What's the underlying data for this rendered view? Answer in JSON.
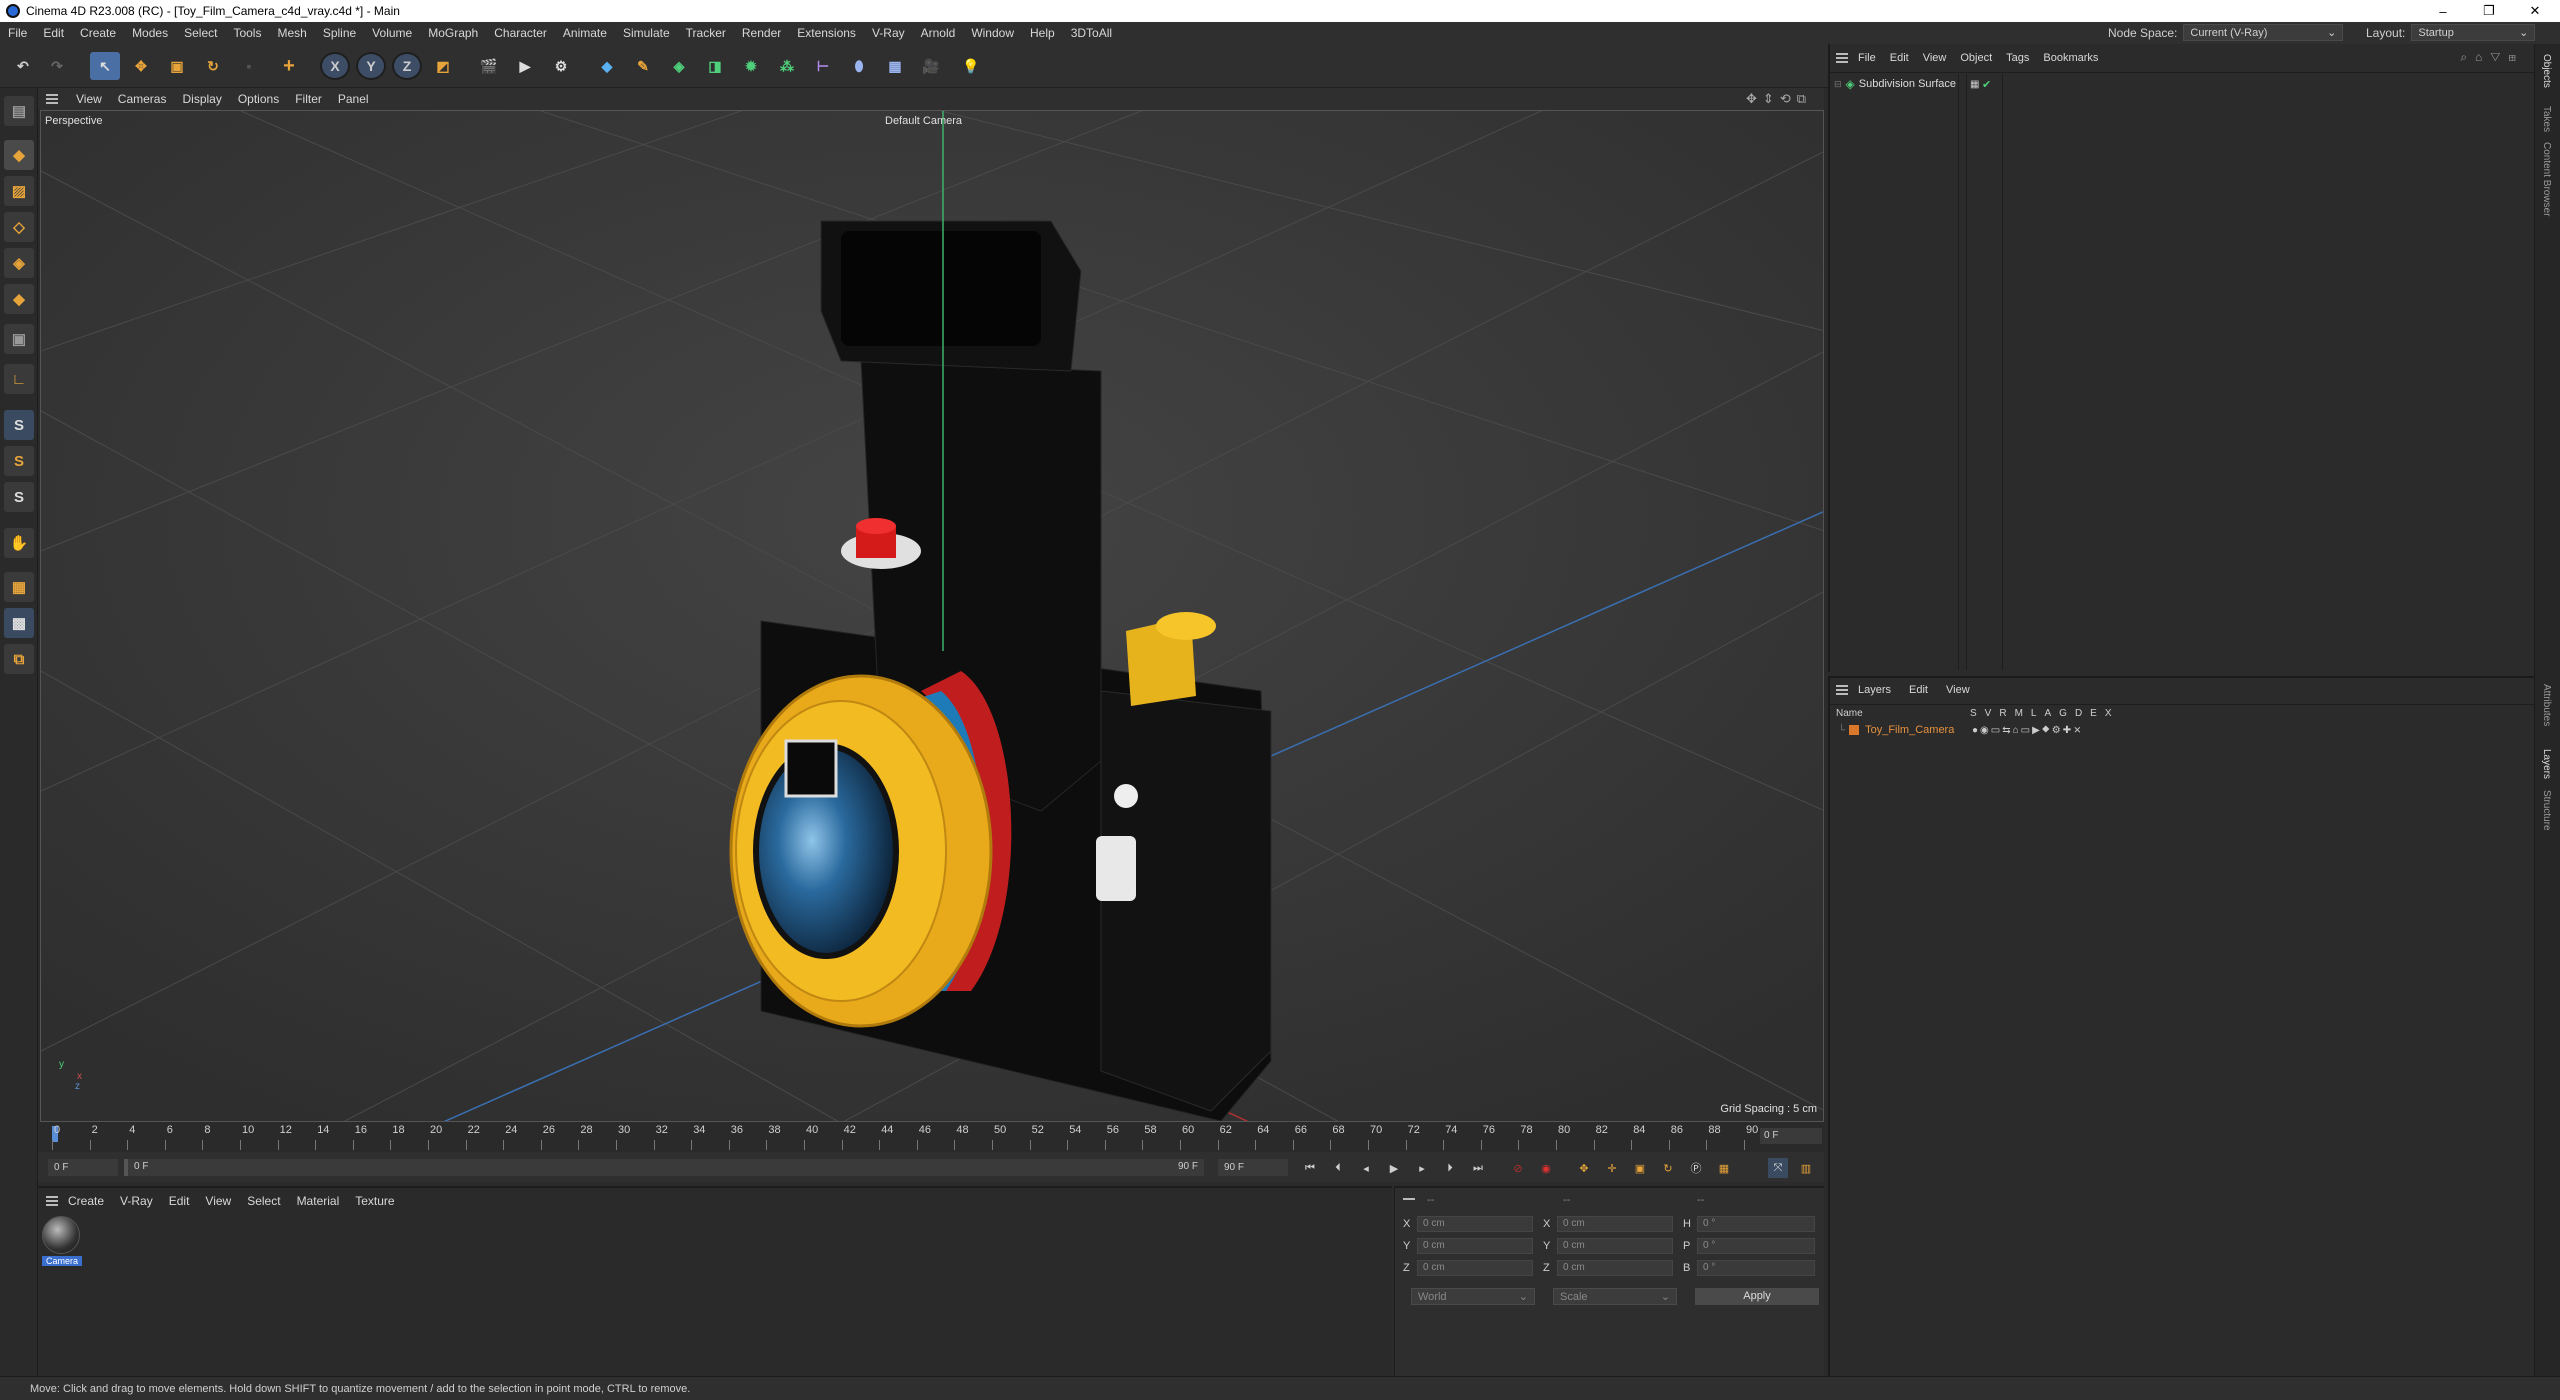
{
  "titlebar": {
    "title": "Cinema 4D R23.008 (RC) - [Toy_Film_Camera_c4d_vray.c4d *] - Main",
    "minimize": "–",
    "maximize": "❐",
    "close": "✕"
  },
  "menu": [
    "File",
    "Edit",
    "Create",
    "Modes",
    "Select",
    "Tools",
    "Mesh",
    "Spline",
    "Volume",
    "MoGraph",
    "Character",
    "Animate",
    "Simulate",
    "Tracker",
    "Render",
    "Extensions",
    "V-Ray",
    "Arnold",
    "Window",
    "Help",
    "3DToAll"
  ],
  "node_space": {
    "label": "Node Space:",
    "value": "Current (V-Ray)"
  },
  "layout": {
    "label": "Layout:",
    "value": "Startup"
  },
  "toolbar": {
    "x": "X",
    "y": "Y",
    "z": "Z"
  },
  "left_tools": {
    "s1": "S",
    "s2": "S",
    "s3": "S"
  },
  "viewport_menu": [
    "View",
    "Cameras",
    "Display",
    "Options",
    "Filter",
    "Panel"
  ],
  "viewport": {
    "view_name": "Perspective",
    "camera": "Default Camera",
    "grid_spacing": "Grid Spacing : 5 cm",
    "axis_x": "x",
    "axis_y": "y",
    "axis_z": "z"
  },
  "timeline": {
    "ticks": [
      "0",
      "2",
      "4",
      "6",
      "8",
      "10",
      "12",
      "14",
      "16",
      "18",
      "20",
      "22",
      "24",
      "26",
      "28",
      "30",
      "32",
      "34",
      "36",
      "38",
      "40",
      "42",
      "44",
      "46",
      "48",
      "50",
      "52",
      "54",
      "56",
      "58",
      "60",
      "62",
      "64",
      "66",
      "68",
      "70",
      "72",
      "74",
      "76",
      "78",
      "80",
      "82",
      "84",
      "86",
      "88",
      "90"
    ],
    "current_frame": "0 F"
  },
  "transport": {
    "start": "0 F",
    "range_start": "0 F",
    "range_end": "90 F",
    "end": "90 F"
  },
  "material_manager": {
    "menu": [
      "Create",
      "V-Ray",
      "Edit",
      "View",
      "Select",
      "Material",
      "Texture"
    ],
    "material_name": "Camera"
  },
  "coordinates": {
    "header": "--",
    "header2": "--",
    "header3": "--",
    "rows": [
      {
        "a": "X",
        "av": "0 cm",
        "b": "X",
        "bv": "0 cm",
        "c": "H",
        "cv": "0 °"
      },
      {
        "a": "Y",
        "av": "0 cm",
        "b": "Y",
        "bv": "0 cm",
        "c": "P",
        "cv": "0 °"
      },
      {
        "a": "Z",
        "av": "0 cm",
        "b": "Z",
        "bv": "0 cm",
        "c": "B",
        "cv": "0 °"
      }
    ],
    "world": "World",
    "scale": "Scale",
    "apply": "Apply"
  },
  "object_manager": {
    "menu": [
      "File",
      "Edit",
      "View",
      "Object",
      "Tags",
      "Bookmarks"
    ],
    "objects": [
      {
        "name": "Subdivision Surface"
      }
    ]
  },
  "layer_manager": {
    "menu": [
      "Layers",
      "Edit",
      "View"
    ],
    "columns": {
      "name": "Name",
      "flags": [
        "S",
        "V",
        "R",
        "M",
        "L",
        "A",
        "G",
        "D",
        "E",
        "X"
      ]
    },
    "layers": [
      {
        "name": "Toy_Film_Camera",
        "color": "#d9772a"
      }
    ]
  },
  "right_tabs": [
    "Objects",
    "Takes",
    "Content Browser",
    "Attributes",
    "Layers",
    "Structure"
  ],
  "status": "Move: Click and drag to move elements. Hold down SHIFT to quantize movement / add to the selection in point mode, CTRL to remove.",
  "colors": {
    "accent_blue": "#4a7fd0",
    "layer_orange": "#d9772a",
    "camera_yellow": "#f1b51c",
    "camera_red": "#c81e1e"
  }
}
